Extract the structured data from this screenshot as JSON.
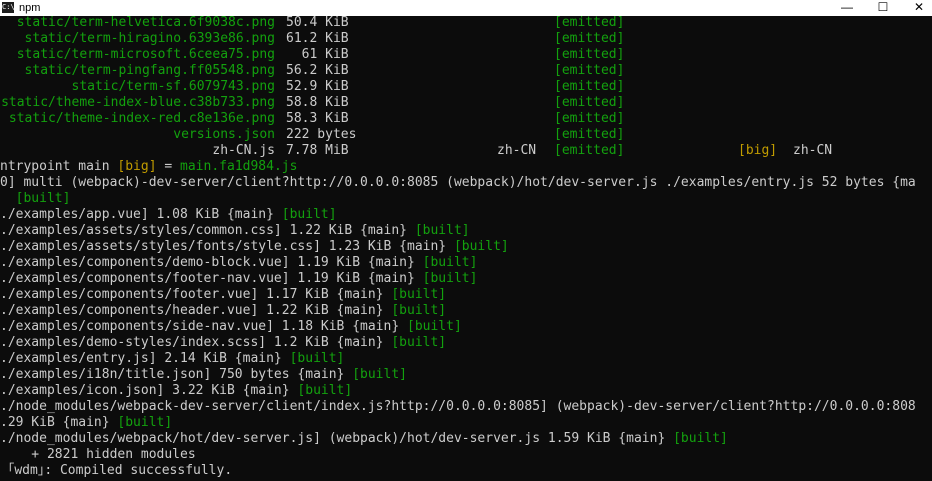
{
  "window": {
    "title": "npm",
    "icon": "terminal-icon",
    "controls": {
      "minimize": "—",
      "maximize": "☐",
      "close": "✕"
    }
  },
  "colors": {
    "background": "#0c0c0c",
    "text": "#cccccc",
    "green": "#13a10e",
    "yellow": "#c19c00"
  },
  "assets": [
    {
      "name": "static/term-helvetica.6f9038c.png",
      "size": "50.4 KiB",
      "chunk": "",
      "status": "[emitted]",
      "flag": "",
      "chunk_name": ""
    },
    {
      "name": "static/term-hiragino.6393e86.png",
      "size": "61.2 KiB",
      "chunk": "",
      "status": "[emitted]",
      "flag": "",
      "chunk_name": ""
    },
    {
      "name": "static/term-microsoft.6ceea75.png",
      "size": "  61 KiB",
      "chunk": "",
      "status": "[emitted]",
      "flag": "",
      "chunk_name": ""
    },
    {
      "name": "static/term-pingfang.ff05548.png",
      "size": "56.2 KiB",
      "chunk": "",
      "status": "[emitted]",
      "flag": "",
      "chunk_name": ""
    },
    {
      "name": "static/term-sf.6079743.png",
      "size": "52.9 KiB",
      "chunk": "",
      "status": "[emitted]",
      "flag": "",
      "chunk_name": ""
    },
    {
      "name": "static/theme-index-blue.c38b733.png",
      "size": "58.8 KiB",
      "chunk": "",
      "status": "[emitted]",
      "flag": "",
      "chunk_name": ""
    },
    {
      "name": "static/theme-index-red.c8e136e.png",
      "size": "58.3 KiB",
      "chunk": "",
      "status": "[emitted]",
      "flag": "",
      "chunk_name": ""
    },
    {
      "name": "versions.json",
      "size": "222 bytes",
      "chunk": "",
      "status": "[emitted]",
      "flag": "",
      "chunk_name": ""
    },
    {
      "name": "zh-CN.js",
      "size": "7.78 MiB",
      "chunk": "zh-CN",
      "status": "[emitted]",
      "flag": "[big]",
      "chunk_name": "zh-CN"
    }
  ],
  "entrypoint": {
    "prefix": "ntrypoint main ",
    "big": "[big]",
    "eq": " = ",
    "file": "main.fa1d984.js"
  },
  "log_lines": [
    [
      {
        "t": "0] multi (webpack)-dev-server/client?http://0.0.0.0:8085 (webpack)/hot/dev-server.js ./examples/entry.js 52 bytes {ma",
        "c": "w"
      }
    ],
    [
      {
        "t": "  [built]",
        "c": "g"
      }
    ],
    [
      {
        "t": "./examples/app.vue] 1.08 KiB {main} ",
        "c": "w"
      },
      {
        "t": "[built]",
        "c": "g"
      }
    ],
    [
      {
        "t": "./examples/assets/styles/common.css] 1.22 KiB {main} ",
        "c": "w"
      },
      {
        "t": "[built]",
        "c": "g"
      }
    ],
    [
      {
        "t": "./examples/assets/styles/fonts/style.css] 1.23 KiB {main} ",
        "c": "w"
      },
      {
        "t": "[built]",
        "c": "g"
      }
    ],
    [
      {
        "t": "./examples/components/demo-block.vue] 1.19 KiB {main} ",
        "c": "w"
      },
      {
        "t": "[built]",
        "c": "g"
      }
    ],
    [
      {
        "t": "./examples/components/footer-nav.vue] 1.19 KiB {main} ",
        "c": "w"
      },
      {
        "t": "[built]",
        "c": "g"
      }
    ],
    [
      {
        "t": "./examples/components/footer.vue] 1.17 KiB {main} ",
        "c": "w"
      },
      {
        "t": "[built]",
        "c": "g"
      }
    ],
    [
      {
        "t": "./examples/components/header.vue] 1.22 KiB {main} ",
        "c": "w"
      },
      {
        "t": "[built]",
        "c": "g"
      }
    ],
    [
      {
        "t": "./examples/components/side-nav.vue] 1.18 KiB {main} ",
        "c": "w"
      },
      {
        "t": "[built]",
        "c": "g"
      }
    ],
    [
      {
        "t": "./examples/demo-styles/index.scss] 1.2 KiB {main} ",
        "c": "w"
      },
      {
        "t": "[built]",
        "c": "g"
      }
    ],
    [
      {
        "t": "./examples/entry.js] 2.14 KiB {main} ",
        "c": "w"
      },
      {
        "t": "[built]",
        "c": "g"
      }
    ],
    [
      {
        "t": "./examples/i18n/title.json] 750 bytes {main} ",
        "c": "w"
      },
      {
        "t": "[built]",
        "c": "g"
      }
    ],
    [
      {
        "t": "./examples/icon.json] 3.22 KiB {main} ",
        "c": "w"
      },
      {
        "t": "[built]",
        "c": "g"
      }
    ],
    [
      {
        "t": "./node_modules/webpack-dev-server/client/index.js?http://0.0.0.0:8085] (webpack)-dev-server/client?http://0.0.0.0:808",
        "c": "w"
      }
    ],
    [
      {
        "t": ".29 KiB {main} ",
        "c": "w"
      },
      {
        "t": "[built]",
        "c": "g"
      }
    ],
    [
      {
        "t": "./node_modules/webpack/hot/dev-server.js] (webpack)/hot/dev-server.js 1.59 KiB {main} ",
        "c": "w"
      },
      {
        "t": "[built]",
        "c": "g"
      }
    ],
    [
      {
        "t": "    + 2821 hidden modules",
        "c": "w"
      }
    ],
    [
      {
        "t": " ｢wdm｣",
        "c": "w"
      },
      {
        "t": ": Compiled successfully.",
        "c": "w"
      }
    ]
  ]
}
